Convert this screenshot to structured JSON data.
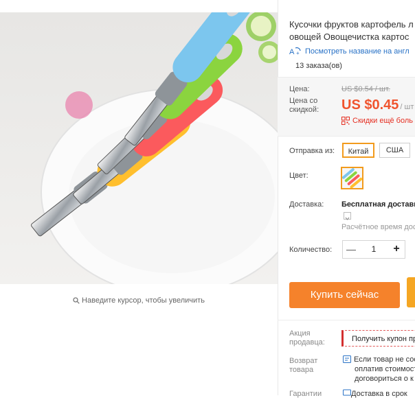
{
  "product": {
    "title_line1": "Кусочки фруктов картофель л",
    "title_line2": "овощей Овощечистка картос",
    "translate_link": "Посмотреть название на англ",
    "orders": "13 заказа(ов)"
  },
  "image": {
    "zoom_hint": "Наведите курсор, чтобы увеличить",
    "peeler_colors": [
      "#ffbf2e",
      "#fb5a5d",
      "#8bd43f",
      "#7cc6ee"
    ]
  },
  "price": {
    "label": "Цена:",
    "old": "US $0.54 / шт.",
    "discount_label": "Цена со скидкой:",
    "new": "US $0.45",
    "unit": "/ шт",
    "more_discounts": "Скидки ещё боль"
  },
  "options": {
    "ship_from_label": "Отправка из:",
    "ship_from_options": [
      "Китай",
      "США"
    ],
    "ship_from_selected": "Китай",
    "color_label": "Цвет:"
  },
  "delivery": {
    "label": "Доставка:",
    "value": "Бесплатная доставк",
    "time": "Расчётное время дос"
  },
  "quantity": {
    "label": "Количество:",
    "value": "1",
    "minus": "—",
    "plus": "+"
  },
  "actions": {
    "buy_now": "Купить сейчас"
  },
  "seller": {
    "promo_label": "Акция продавца:",
    "coupon_button": "Получить купон пр"
  },
  "returns": {
    "label": "Возврат товара",
    "line1": "Если товар не соо",
    "line2": "оплатив стоимост",
    "line3": "договориться о к"
  },
  "guarantee": {
    "label": "Гарантии",
    "text": "Доставка в срок"
  },
  "colors": {
    "accent": "#f5822b",
    "price": "#f0542e",
    "selected_border": "#f29b1c",
    "link": "#2771c6"
  }
}
